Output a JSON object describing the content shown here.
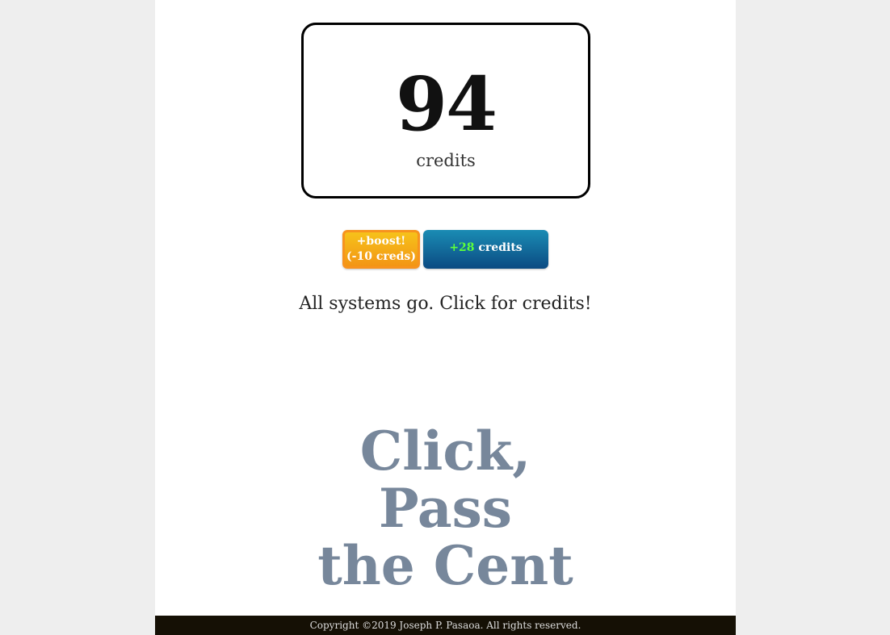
{
  "counter": {
    "value": "94",
    "unit": "credits"
  },
  "buttons": {
    "boost_line1": "+boost!",
    "boost_line2": "(-10 creds)",
    "click_amount": "+28",
    "click_label": " credits"
  },
  "status": "All systems go. Click for credits!",
  "headline": {
    "line1": "Click,",
    "line2": "Pass",
    "line3": "the Cent"
  },
  "footer": "Copyright ©2019 Joseph P. Pasaoa. All rights reserved.",
  "colors": {
    "page_background": "#eeeeee",
    "content_background": "#ffffff",
    "boost_button": "#f39c12",
    "click_button": "#0d5a8f",
    "gain_text": "#5cff3c",
    "headline": "#77879b",
    "footer_background": "#151005"
  }
}
